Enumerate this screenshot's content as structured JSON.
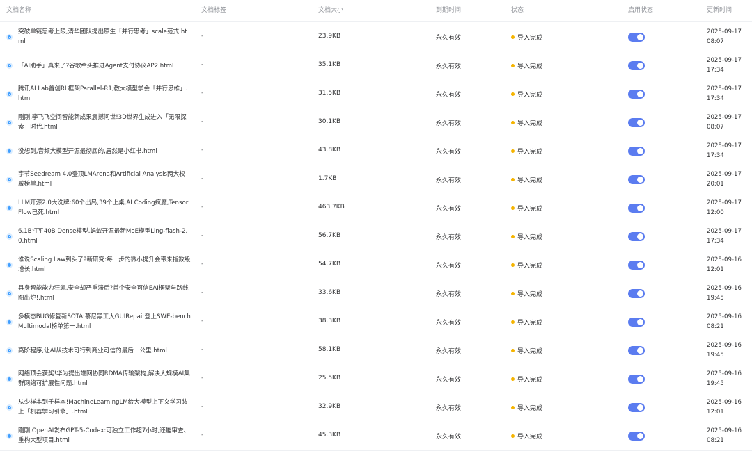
{
  "table": {
    "columns": {
      "name": "文档名称",
      "tag": "文档标签",
      "size": "文档大小",
      "expiry": "到期时间",
      "status": "状态",
      "enabled": "启用状态",
      "updated": "更新时间"
    },
    "status_color": "#f5b400",
    "switch_color": "#5b7cf0",
    "rows": [
      {
        "name": "突破单链思考上限,清华团队提出原生「并行思考」scale范式.html",
        "tag": "-",
        "size": "23.9KB",
        "expiry": "永久有效",
        "status": "导入完成",
        "enabled": true,
        "date": "2025-09-17",
        "time": "08:07"
      },
      {
        "name": "「AI助手」真来了?谷歌牵头推进Agent支付协议AP2.html",
        "tag": "-",
        "size": "35.1KB",
        "expiry": "永久有效",
        "status": "导入完成",
        "enabled": true,
        "date": "2025-09-17",
        "time": "17:34"
      },
      {
        "name": "腾讯AI Lab首创RL框架Parallel-R1,教大模型学会「并行思维」.html",
        "tag": "-",
        "size": "31.5KB",
        "expiry": "永久有效",
        "status": "导入完成",
        "enabled": true,
        "date": "2025-09-17",
        "time": "17:34"
      },
      {
        "name": "刚刚,李飞飞空间智能新成果震撼问世!3D世界生成进入「无限探索」时代.html",
        "tag": "-",
        "size": "30.1KB",
        "expiry": "永久有效",
        "status": "导入完成",
        "enabled": true,
        "date": "2025-09-17",
        "time": "08:07"
      },
      {
        "name": "没想到,音频大模型开源最彻底的,居然是小红书.html",
        "tag": "-",
        "size": "43.8KB",
        "expiry": "永久有效",
        "status": "导入完成",
        "enabled": true,
        "date": "2025-09-17",
        "time": "17:34"
      },
      {
        "name": "字节Seedream 4.0登顶LMArena和Artificial Analysis两大权威榜单.html",
        "tag": "-",
        "size": "1.7KB",
        "expiry": "永久有效",
        "status": "导入完成",
        "enabled": true,
        "date": "2025-09-17",
        "time": "20:01"
      },
      {
        "name": "LLM开源2.0大洗牌:60个出局,39个上桌,AI Coding疯魔,TensorFlow已死.html",
        "tag": "-",
        "size": "463.7KB",
        "expiry": "永久有效",
        "status": "导入完成",
        "enabled": true,
        "date": "2025-09-17",
        "time": "12:00"
      },
      {
        "name": "6.1B打平40B Dense模型,蚂蚁开源最新MoE模型Ling-flash-2.0.html",
        "tag": "-",
        "size": "56.7KB",
        "expiry": "永久有效",
        "status": "导入完成",
        "enabled": true,
        "date": "2025-09-17",
        "time": "17:34"
      },
      {
        "name": "谁说Scaling Law到头了?新研究:每一步的微小提升会带来指数级增长.html",
        "tag": "-",
        "size": "54.7KB",
        "expiry": "永久有效",
        "status": "导入完成",
        "enabled": true,
        "date": "2025-09-16",
        "time": "12:01"
      },
      {
        "name": "具身智能能力狂飙,安全却严重滞后?首个安全可信EAI框架与路线图出炉!.html",
        "tag": "-",
        "size": "33.6KB",
        "expiry": "永久有效",
        "status": "导入完成",
        "enabled": true,
        "date": "2025-09-16",
        "time": "19:45"
      },
      {
        "name": "多模态BUG修复新SOTA:慕尼黑工大GUIRepair登上SWE-bench Multimodal榜单第一.html",
        "tag": "-",
        "size": "38.3KB",
        "expiry": "永久有效",
        "status": "导入完成",
        "enabled": true,
        "date": "2025-09-16",
        "time": "08:21"
      },
      {
        "name": "高阶程序,让AI从技术可行到商业可信的最后一公里.html",
        "tag": "-",
        "size": "58.1KB",
        "expiry": "永久有效",
        "status": "导入完成",
        "enabled": true,
        "date": "2025-09-16",
        "time": "19:45"
      },
      {
        "name": "网络顶会获奖!华为提出端网协同RDMA传输架构,解决大规模AI集群网络可扩展性问题.html",
        "tag": "-",
        "size": "25.5KB",
        "expiry": "永久有效",
        "status": "导入完成",
        "enabled": true,
        "date": "2025-09-16",
        "time": "19:45"
      },
      {
        "name": "从少样本到千样本!MachineLearningLM给大模型上下文学习装上「机器学习引擎」.html",
        "tag": "-",
        "size": "32.9KB",
        "expiry": "永久有效",
        "status": "导入完成",
        "enabled": true,
        "date": "2025-09-16",
        "time": "12:01"
      },
      {
        "name": "刚刚,OpenAI发布GPT-5-Codex:可独立工作超7小时,还能审查、重构大型项目.html",
        "tag": "-",
        "size": "45.3KB",
        "expiry": "永久有效",
        "status": "导入完成",
        "enabled": true,
        "date": "2025-09-16",
        "time": "08:21"
      }
    ]
  }
}
